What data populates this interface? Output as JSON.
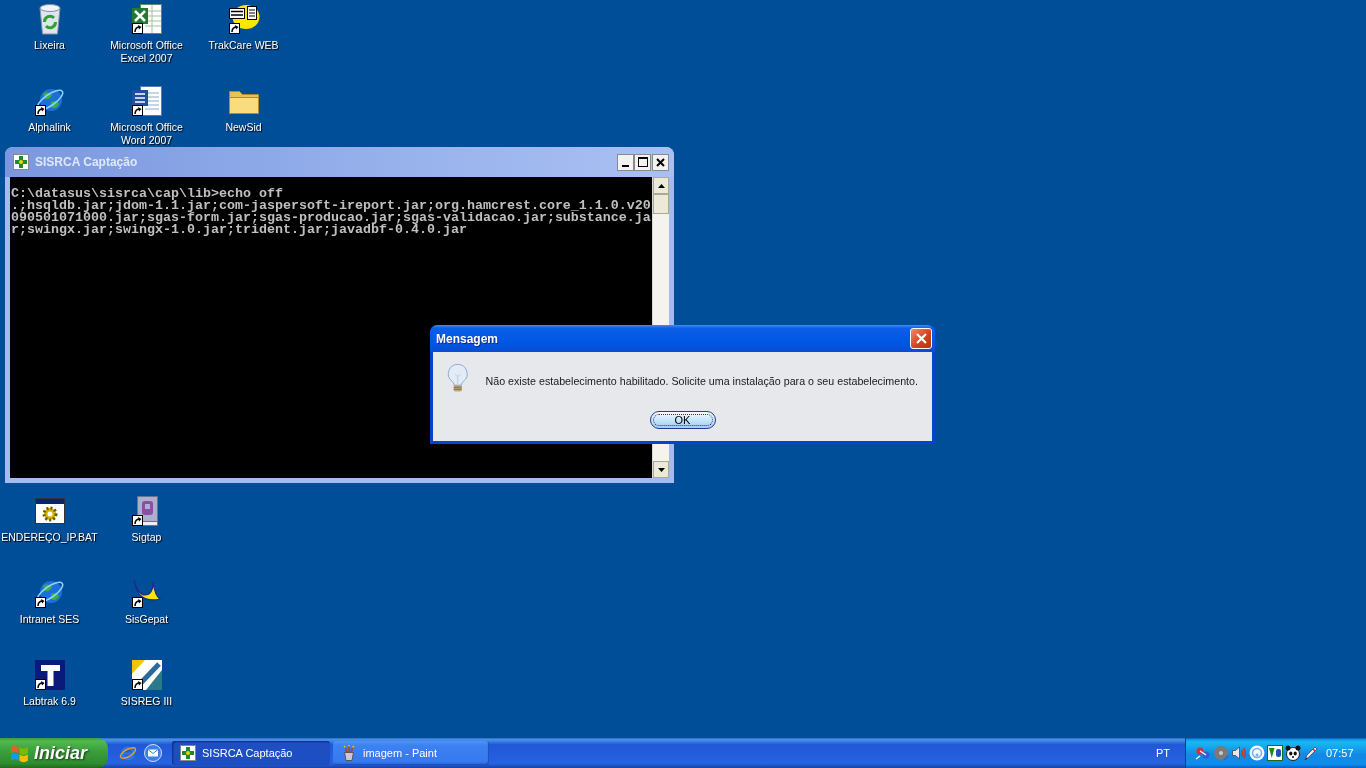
{
  "desktop_icons_top": [
    {
      "label": "Lixeira",
      "kind": "recycle_bin",
      "shortcut": false
    },
    {
      "label": "Microsoft Office Excel 2007",
      "kind": "spreadsheet",
      "shortcut": true
    },
    {
      "label": "TrakCare WEB",
      "kind": "trakcare",
      "shortcut": true
    },
    {
      "label": "Alphalink",
      "kind": "globe",
      "shortcut": true
    },
    {
      "label": "Microsoft Office Word 2007",
      "kind": "document",
      "shortcut": true
    },
    {
      "label": "NewSid",
      "kind": "folder",
      "shortcut": false
    }
  ],
  "desktop_icons_bottom": [
    {
      "label": "ENDEREÇO_IP.BAT",
      "kind": "batch",
      "shortcut": false
    },
    {
      "label": "Sigtap",
      "kind": "book",
      "shortcut": true
    },
    {
      "label": "Intranet SES",
      "kind": "globe",
      "shortcut": true
    },
    {
      "label": "SisGepat",
      "kind": "swoosh",
      "shortcut": true
    },
    {
      "label": "Labtrak 6.9",
      "kind": "labtrak",
      "shortcut": true
    },
    {
      "label": "SISREG III",
      "kind": "sisreg",
      "shortcut": true
    }
  ],
  "console_window": {
    "title": "SISRCA Captação",
    "active": false,
    "lines": [
      "C:\\datasus\\sisrca\\cap\\lib>echo off",
      ".;hsqldb.jar;jdom-1.1.jar;com-jaspersoft-ireport.jar;org.hamcrest.core_1.1.0.v20",
      "090501071000.jar;sgas-form.jar;sgas-producao.jar;sgas-validacao.jar;substance.ja",
      "r;swingx.jar;swingx-1.0.jar;trident.jar;javadbf-0.4.0.jar"
    ]
  },
  "message_dialog": {
    "title": "Mensagem",
    "active": true,
    "message": "Não existe estabelecimento habilitado. Solicite uma instalação para o seu estabelecimento.",
    "button": "OK"
  },
  "taskbar": {
    "start_button": "Iniciar",
    "tasks": [
      {
        "label": "SISRCA Captação",
        "kind": "sisrca",
        "selected": true
      },
      {
        "label": "imagem - Paint",
        "kind": "paint",
        "selected": false
      }
    ],
    "language": "PT",
    "clock": "07:57"
  }
}
